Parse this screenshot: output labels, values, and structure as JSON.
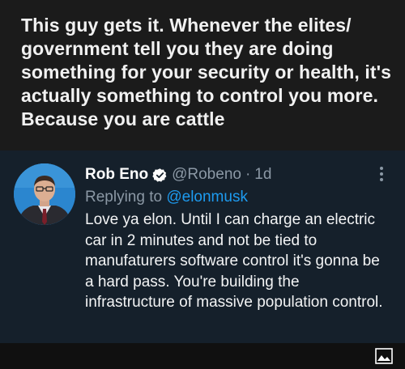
{
  "caption": {
    "text": "This guy gets it. Whenever the elites/ government tell you they are doing something for your security or health, it's actually something to control you more. Because you are cattle"
  },
  "tweet": {
    "display_name": "Rob Eno",
    "handle": "@Robeno",
    "separator": "·",
    "time": "1d",
    "replying_prefix": "Replying to ",
    "replying_to": "@elonmusk",
    "body": "Love ya elon. Until I can charge an electric car in 2 minutes and not be tied to manufaturers software control it's gonna be a hard pass. You're building the infrastructure of massive population control.",
    "icons": {
      "verified": "verified-badge-icon",
      "more": "more-options-icon",
      "media": "image-icon"
    }
  },
  "colors": {
    "background": "#1b1b1b",
    "tweet_background": "#15202b",
    "secondary_text": "#8b98a5",
    "accent": "#1d9bf0"
  }
}
